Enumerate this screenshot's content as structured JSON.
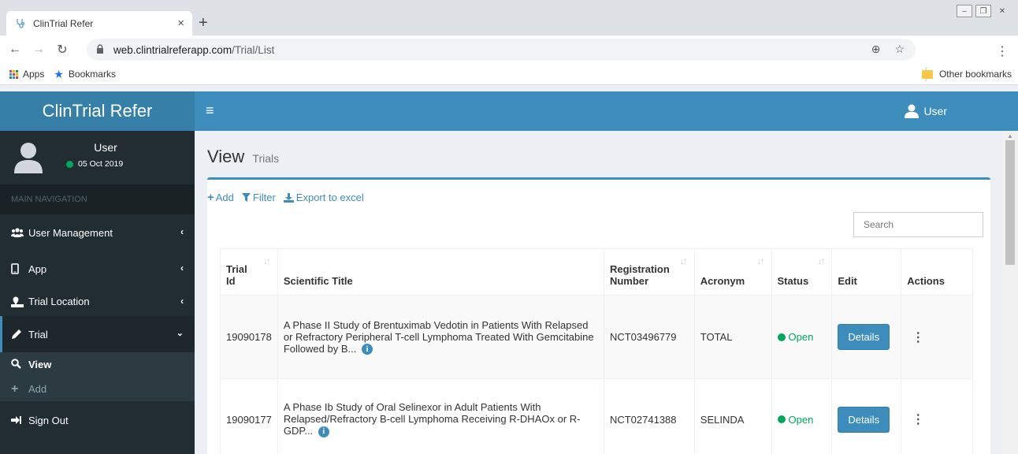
{
  "browser": {
    "tab_title": "ClinTrial Refer",
    "url_host": "web.clintrialreferapp.com",
    "url_path": "/Trial/List",
    "bookmarks": {
      "apps": "Apps",
      "bookmarks": "Bookmarks",
      "other": "Other bookmarks"
    }
  },
  "app": {
    "brand": "ClinTrial Refer",
    "top_user": "User"
  },
  "sidebar": {
    "user_name": "User",
    "user_date": "05 Oct 2019",
    "header": "MAIN NAVIGATION",
    "items": [
      {
        "label": "User Management",
        "icon": "users-icon"
      },
      {
        "label": "App",
        "icon": "mobile-icon"
      },
      {
        "label": "Trial Location",
        "icon": "map-icon"
      },
      {
        "label": "Trial",
        "icon": "pen-icon"
      }
    ],
    "sub": [
      {
        "label": "View",
        "icon": "search-icon"
      },
      {
        "label": "Add",
        "icon": "plus-icon"
      }
    ],
    "signout": "Sign Out"
  },
  "page": {
    "title": "View",
    "subtitle": "Trials",
    "toolbar": {
      "add": "Add",
      "filter": "Filter",
      "export": "Export to excel"
    },
    "search_placeholder": "Search"
  },
  "table": {
    "headers": {
      "trial_id_1": "Trial",
      "trial_id_2": "Id",
      "title": "Scientific Title",
      "reg_1": "Registration",
      "reg_2": "Number",
      "acronym": "Acronym",
      "status": "Status",
      "edit": "Edit",
      "actions": "Actions"
    },
    "rows": [
      {
        "id": "19090178",
        "title": "A Phase II Study of Brentuximab Vedotin in Patients With Relapsed or Refractory Peripheral T-cell Lymphoma Treated With Gemcitabine Followed by B...",
        "reg": "NCT03496779",
        "acronym": "TOTAL",
        "status": "Open",
        "edit": "Details"
      },
      {
        "id": "19090177",
        "title": "A Phase Ib Study of Oral Selinexor in Adult Patients With Relapsed/Refractory B-cell Lymphoma Receiving R-DHAOx or R-GDP...",
        "reg": "NCT02741388",
        "acronym": "SELINDA",
        "status": "Open",
        "edit": "Details"
      }
    ]
  },
  "colors": {
    "primary": "#3c8dbc",
    "logo": "#367fa9",
    "sidebar": "#222d32",
    "open": "#00a65a"
  }
}
